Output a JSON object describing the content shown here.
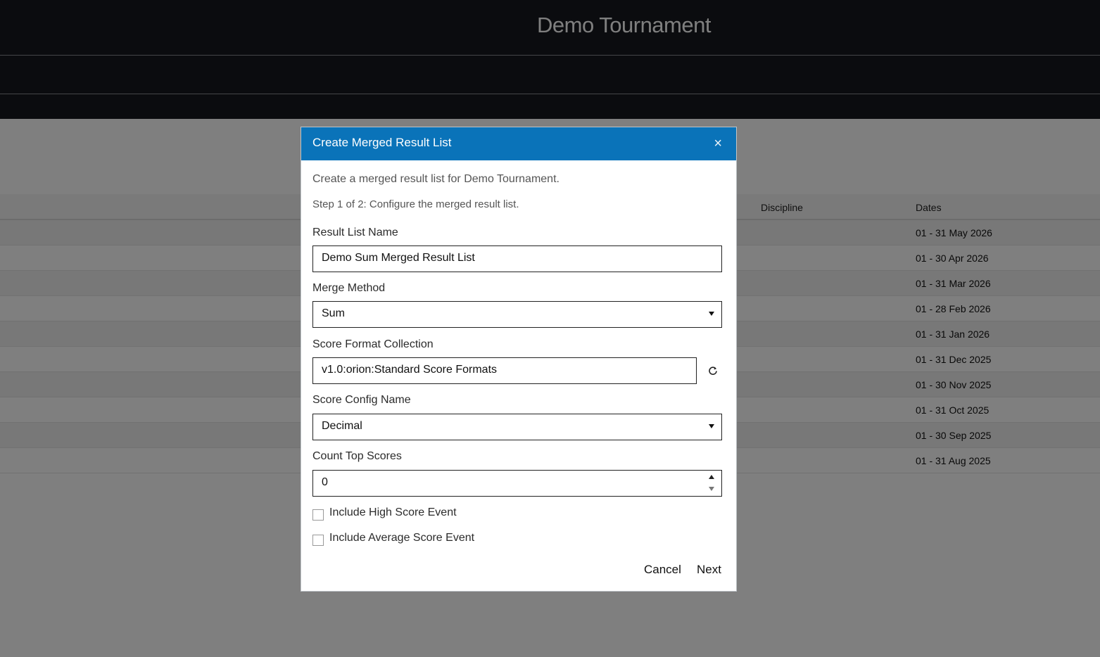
{
  "page": {
    "title": "Demo Tournament"
  },
  "table": {
    "columns": [
      "Discipline",
      "Dates"
    ],
    "rows": [
      "01 - 31 May 2026",
      "01 - 30 Apr 2026",
      "01 - 31 Mar 2026",
      "01 - 28 Feb 2026",
      "01 - 31 Jan 2026",
      "01 - 31 Dec 2025",
      "01 - 30 Nov 2025",
      "01 - 31 Oct 2025",
      "01 - 30 Sep 2025",
      "01 - 31 Aug 2025"
    ]
  },
  "modal": {
    "title": "Create Merged Result List",
    "close_symbol": "×",
    "intro": "Create a merged result list for Demo Tournament.",
    "step": "Step 1 of 2: Configure the merged result list.",
    "fields": {
      "name_label": "Result List Name",
      "name_value": "Demo Sum Merged Result List",
      "method_label": "Merge Method",
      "method_value": "Sum",
      "collection_label": "Score Format Collection",
      "collection_value": "v1.0:orion:Standard Score Formats",
      "config_label": "Score Config Name",
      "config_value": "Decimal",
      "top_label": "Count Top Scores",
      "top_value": "0"
    },
    "checkboxes": {
      "high": "Include High Score Event",
      "avg": "Include Average Score Event"
    },
    "buttons": {
      "cancel": "Cancel",
      "next": "Next"
    }
  },
  "colors": {
    "header_bg": "#16191e",
    "modal_header": "#0a73b9"
  }
}
